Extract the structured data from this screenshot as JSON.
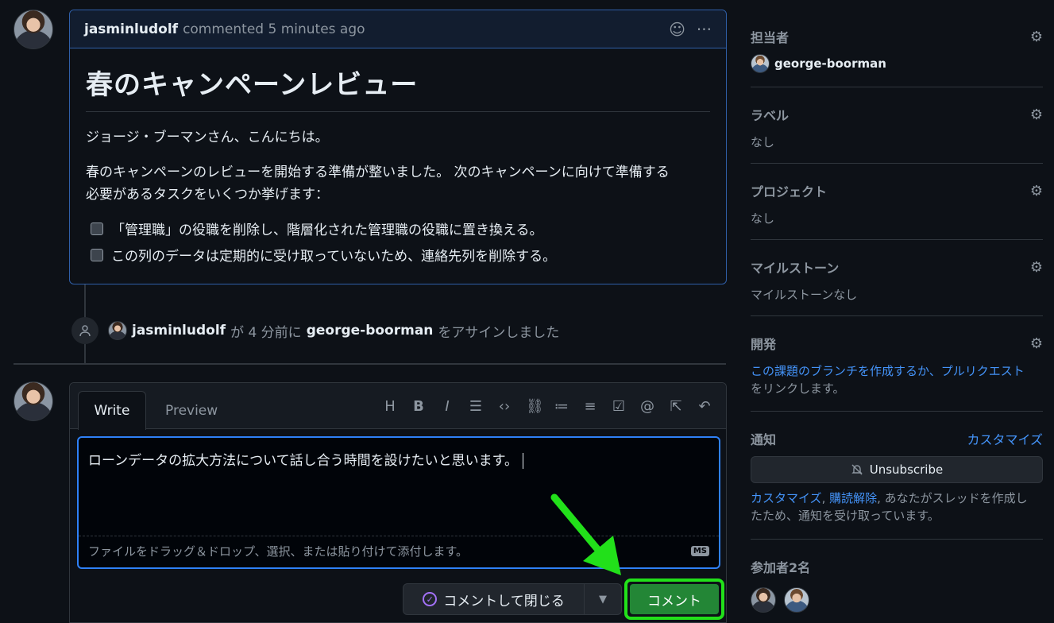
{
  "comment": {
    "author": "jasminludolf",
    "meta": "commented 5 minutes ago",
    "title": "春のキャンペーンレビュー",
    "greeting": "ジョージ・ブーマンさん、こんにちは。",
    "intro_line1": "春のキャンペーンのレビューを開始する準備が整いました。 次のキャンペーンに向けて準備する",
    "intro_line2": "必要があるタスクをいくつか挙げます：",
    "tasks": [
      "「管理職」の役職を削除し、階層化された管理職の役職に置き換える。",
      "この列のデータは定期的に受け取っていないため、連絡先列を削除する。"
    ]
  },
  "assign_event": {
    "actor": "jasminludolf",
    "text_mid": "が 4 分前に",
    "assignee": "george-boorman",
    "text_end": "をアサインしました"
  },
  "editor": {
    "tab_write": "Write",
    "tab_preview": "Preview",
    "toolbar_icons": [
      "heading-icon",
      "bold-icon",
      "italic-icon",
      "quote-icon",
      "code-icon",
      "link-icon",
      "bulleted-list-icon",
      "numbered-list-icon",
      "task-list-icon",
      "mention-icon",
      "reference-icon",
      "undo-icon"
    ],
    "text": "ローンデータの拡大方法について話し合う時間を設けたいと思います。",
    "attach_hint": "ファイルをドラッグ＆ドロップ、選択、または貼り付けて添付します。",
    "md_badge": "MS"
  },
  "buttons": {
    "close_with_comment": "コメントして閉じる",
    "comment": "コメント"
  },
  "sidebar": {
    "assignees_title": "担当者",
    "assignee": "george-boorman",
    "labels_title": "ラベル",
    "labels_value": "なし",
    "projects_title": "プロジェクト",
    "projects_value": "なし",
    "milestone_title": "マイルストーン",
    "milestone_value": "マイルストーンなし",
    "development_title": "開発",
    "development_link": "この課題のブランチを作成するか、プルリクエスト",
    "development_text": "をリンクします。",
    "notifications_title": "通知",
    "customize": "カスタマイズ",
    "unsubscribe": "Unsubscribe",
    "notif_link1": "カスタマイズ",
    "notif_sep": ", ",
    "notif_link2": "購読解除",
    "notif_text1": ", あなたがスレッドを作成し",
    "notif_text2": "たため、通知を受け取っています。",
    "participants_title": "参加者2名"
  },
  "colors": {
    "accent_blue": "#2f81f7",
    "primary_green": "#238636",
    "highlight_green": "#22e01a"
  }
}
